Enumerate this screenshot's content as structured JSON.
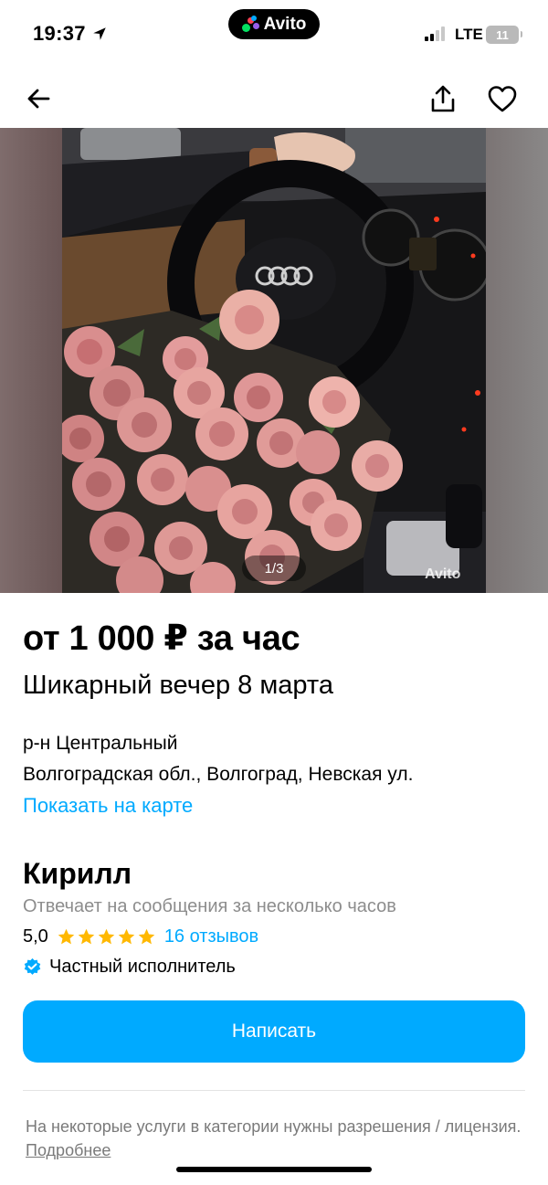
{
  "status_bar": {
    "time": "19:37",
    "network": "LTE",
    "battery": "11",
    "brand": "Avito"
  },
  "gallery": {
    "counter": "1/3",
    "watermark": "Avito"
  },
  "listing": {
    "price": "от 1 000 ₽ за час",
    "title": "Шикарный вечер 8 марта",
    "district": "р-н Центральный",
    "address": "Волгоградская обл., Волгоград, Невская ул.",
    "map_link": "Показать на карте"
  },
  "seller": {
    "name": "Кирилл",
    "reply_time": "Отвечает на сообщения за несколько часов",
    "rating": "5,0",
    "stars": 5,
    "reviews": "16 отзывов",
    "type": "Частный исполнитель"
  },
  "cta": {
    "label": "Написать"
  },
  "notice": {
    "text": "На некоторые услуги в категории нужны разрешения / лицензия.",
    "link": "Подробнее"
  },
  "colors": {
    "accent": "#00aaff",
    "star": "#ffb800",
    "muted": "#8d8d8d"
  },
  "icons": [
    "location-arrow-icon",
    "back-arrow-icon",
    "share-icon",
    "favorite-heart-icon",
    "star-icon",
    "verified-badge-icon"
  ]
}
